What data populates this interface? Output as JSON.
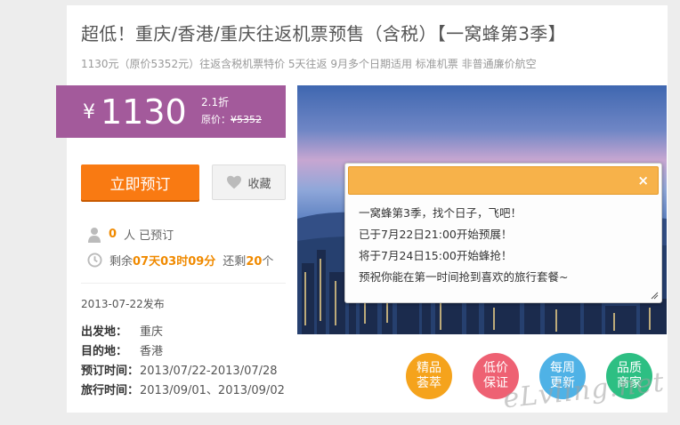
{
  "header": {
    "title": "超低！重庆/香港/重庆往返机票预售（含税）【一窝蜂第3季】",
    "subtitle": "1130元（原价5352元）往返含税机票特价 5天往返 9月多个日期适用 标准机票 非普通廉价航空"
  },
  "price": {
    "currency": "¥",
    "amount": "1130",
    "discount": "2.1折",
    "original_label": "原价：",
    "original_price": "¥5352"
  },
  "actions": {
    "book_label": "立即预订",
    "fav_label": "收藏"
  },
  "stats": {
    "booked_count": "0",
    "booked_suffix": "人 已预订",
    "remaining_prefix": "剩余",
    "remaining_time": "07天03时09分",
    "left_prefix": "还剩",
    "left_count": "20",
    "left_suffix": "个"
  },
  "publish_date": "2013-07-22发布",
  "details": [
    {
      "label": "出发地：",
      "value": "重庆"
    },
    {
      "label": "目的地：",
      "value": "香港"
    },
    {
      "label": "预订时间：",
      "value": "2013/07/22-2013/07/28"
    },
    {
      "label": "旅行时间：",
      "value": "2013/09/01、2013/09/02"
    }
  ],
  "tooltip": {
    "close": "×",
    "lines": [
      "一窝蜂第3季，找个日子，飞吧！",
      "已于7月22日21:00开始预展！",
      "将于7月24日15:00开始蜂抢！",
      "预祝你能在第一时间抢到喜欢的旅行套餐~"
    ]
  },
  "badges": [
    {
      "line1": "精品",
      "line2": "荟萃",
      "color": "#f5a31c"
    },
    {
      "line1": "低价",
      "line2": "保证",
      "color": "#ee6173"
    },
    {
      "line1": "每周",
      "line2": "更新",
      "color": "#4fb2e6"
    },
    {
      "line1": "品质",
      "line2": "商家",
      "color": "#2dbf83"
    }
  ],
  "watermark": "eLvling.net",
  "colors": {
    "price_bg": "#a35a9b",
    "book_button": "#f97a12",
    "accent_orange": "#f08a00",
    "tooltip_bar": "#f7b24a"
  }
}
